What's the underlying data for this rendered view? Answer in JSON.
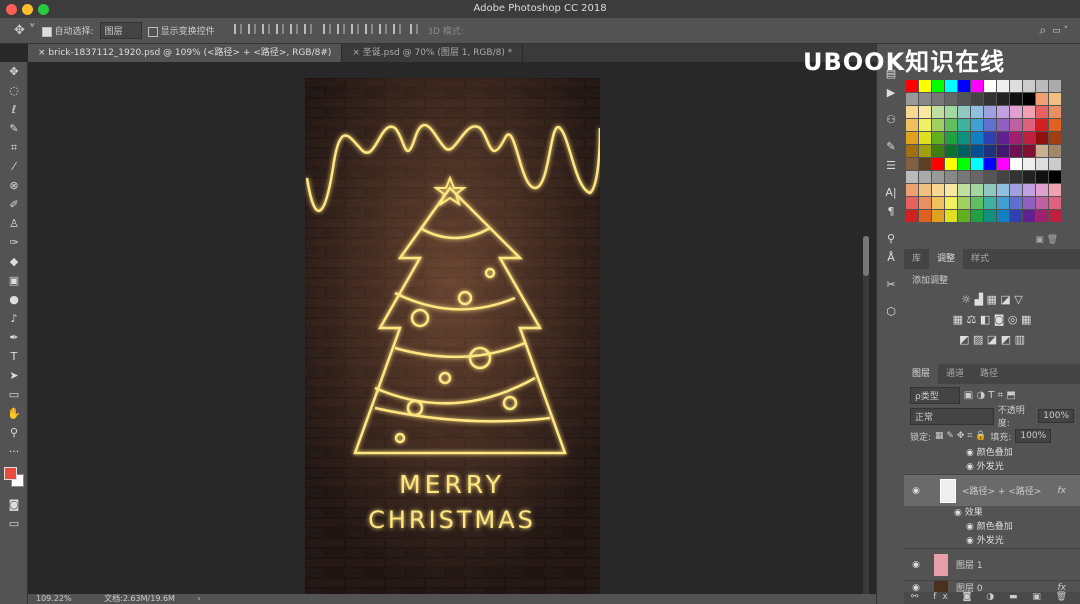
{
  "app": {
    "title": "Adobe Photoshop CC 2018",
    "watermark": "UBOOK知识在线"
  },
  "options": {
    "auto_select": "自动选择:",
    "auto_select_value": "图层",
    "show_transform": "显示变换控件",
    "mode_3d": "3D 模式:"
  },
  "tabs": [
    {
      "label": "brick-1837112_1920.psd @ 109% (<路径> + <路径>, RGB/8#)",
      "active": true
    },
    {
      "label": "圣诞.psd @ 70% (图层 1, RGB/8) *",
      "active": false
    }
  ],
  "swatch_colors": [
    "#ff0000",
    "#ffff00",
    "#00ff00",
    "#00ffff",
    "#0000ff",
    "#ff00ff",
    "#ffffff",
    "#eeeeee",
    "#dddddd",
    "#cccccc",
    "#bbbbbb",
    "#aaaaaa",
    "#999999",
    "#888888",
    "#777777",
    "#666666",
    "#555555",
    "#444444",
    "#333333",
    "#222222",
    "#111111",
    "#000000",
    "#f0a070",
    "#f0c080",
    "#f8d890",
    "#f8e8a0",
    "#c0e0a0",
    "#a0d8a0",
    "#90c8c0",
    "#90c0e0",
    "#a0a0e0",
    "#c0a0e0",
    "#e0a0d0",
    "#f0a0b0",
    "#e86060",
    "#e89060",
    "#f0c060",
    "#f0f060",
    "#a0d060",
    "#60c060",
    "#40b0a0",
    "#40a0d0",
    "#6070d0",
    "#9060c0",
    "#c060a0",
    "#e06080",
    "#d02020",
    "#e06020",
    "#e0a020",
    "#e0e020",
    "#60b020",
    "#20a040",
    "#109080",
    "#1080c0",
    "#3040b0",
    "#602090",
    "#a02070",
    "#c02040",
    "#901010",
    "#a04010",
    "#a07010",
    "#a0a010",
    "#408010",
    "#107030",
    "#006060",
    "#005090",
    "#203080",
    "#401870",
    "#701050",
    "#801030",
    "#c8b090",
    "#a08868",
    "#806040",
    "#604020"
  ],
  "panels": {
    "adjust_tabs": [
      "库",
      "调整",
      "样式"
    ],
    "adjust_title": "添加调整",
    "layer_tabs": [
      "图层",
      "通道",
      "路径"
    ],
    "filter": "ρ类型",
    "blend_mode": "正常",
    "opacity_label": "不透明度:",
    "opacity": "100%",
    "lock_label": "锁定:",
    "fill_label": "填充:",
    "fill": "100%",
    "layers": [
      {
        "sub": [
          "颜色叠加",
          "外发光"
        ]
      },
      {
        "name": "<路径> + <路径>",
        "fx": "fx",
        "selected": true,
        "sub": [
          "效果",
          "颜色叠加",
          "外发光"
        ]
      },
      {
        "name": "图层 1"
      },
      {
        "name": "图层 0",
        "fx": "fx"
      }
    ]
  },
  "status": {
    "zoom": "109.22%",
    "doc": "文档:2.63M/19.6M"
  },
  "art": {
    "line1": "MERRY",
    "line2": "CHRISTMAS",
    "neon": "#ffe680"
  }
}
